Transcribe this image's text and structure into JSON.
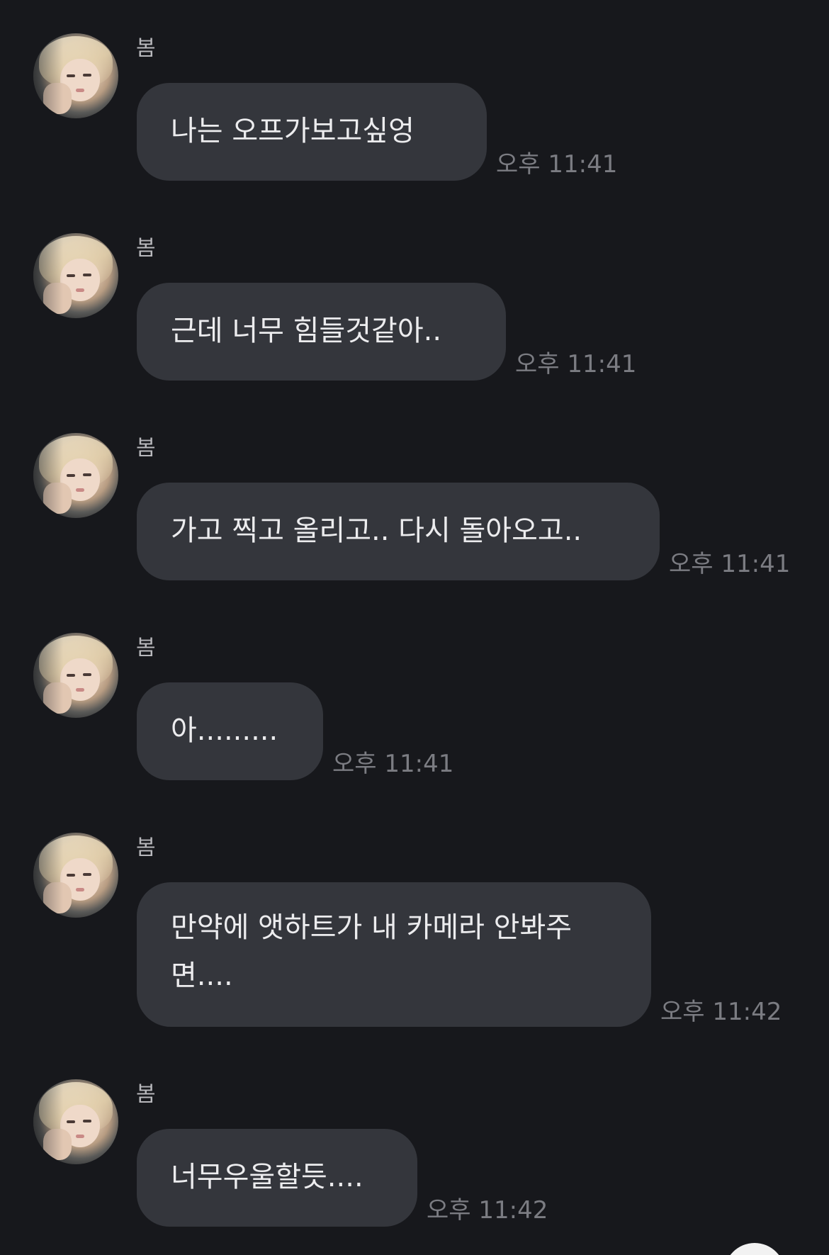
{
  "messages": [
    {
      "sender": "봄",
      "text": "나는 오프가보고싶엉",
      "time": "오후 11:41"
    },
    {
      "sender": "봄",
      "text": "근데 너무 힘들것같아..",
      "time": "오후 11:41"
    },
    {
      "sender": "봄",
      "text": "가고 찍고 올리고.. 다시 돌아오고..",
      "time": "오후 11:41"
    },
    {
      "sender": "봄",
      "text": "아.........",
      "time": "오후 11:41"
    },
    {
      "sender": "봄",
      "text_line1": "만약에 앳하트가 내 카메라 안봐주",
      "text_line2": "면....",
      "time": "오후 11:42"
    },
    {
      "sender": "봄",
      "text": "너무우울할듯....",
      "time": "오후 11:42"
    }
  ],
  "colors": {
    "background": "#17181c",
    "bubble": "#34363c",
    "bubble_text": "#ececee",
    "time_text": "#7b7c82"
  }
}
